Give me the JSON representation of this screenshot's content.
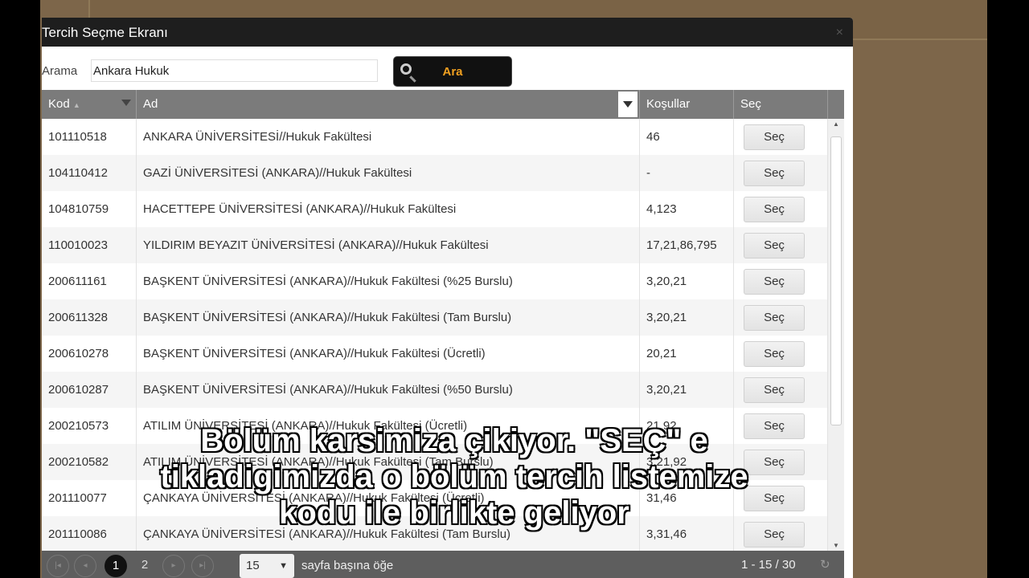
{
  "dialog": {
    "title": "Tercih Seçme Ekranı",
    "close": "×"
  },
  "search": {
    "label": "Arama",
    "value": "Ankara Hukuk",
    "button": "Ara"
  },
  "grid": {
    "headers": {
      "kod": "Kod",
      "sort": "▲",
      "ad": "Ad",
      "kosullar": "Koşullar",
      "sec": "Seç"
    },
    "rows": [
      {
        "kod": "101110518",
        "ad": "ANKARA ÜNİVERSİTESİ//Hukuk Fakültesi",
        "kosullar": "46",
        "btn": "Seç"
      },
      {
        "kod": "104110412",
        "ad": "GAZİ ÜNİVERSİTESİ (ANKARA)//Hukuk Fakültesi",
        "kosullar": "-",
        "btn": "Seç"
      },
      {
        "kod": "104810759",
        "ad": "HACETTEPE ÜNİVERSİTESİ (ANKARA)//Hukuk Fakültesi",
        "kosullar": "4,123",
        "btn": "Seç"
      },
      {
        "kod": "110010023",
        "ad": "YILDIRIM BEYAZIT ÜNİVERSİTESİ (ANKARA)//Hukuk Fakültesi",
        "kosullar": "17,21,86,795",
        "btn": "Seç"
      },
      {
        "kod": "200611161",
        "ad": "BAŞKENT ÜNİVERSİTESİ (ANKARA)//Hukuk Fakültesi (%25 Burslu)",
        "kosullar": "3,20,21",
        "btn": "Seç"
      },
      {
        "kod": "200611328",
        "ad": "BAŞKENT ÜNİVERSİTESİ (ANKARA)//Hukuk Fakültesi (Tam Burslu)",
        "kosullar": "3,20,21",
        "btn": "Seç"
      },
      {
        "kod": "200610278",
        "ad": "BAŞKENT ÜNİVERSİTESİ (ANKARA)//Hukuk Fakültesi (Ücretli)",
        "kosullar": "20,21",
        "btn": "Seç"
      },
      {
        "kod": "200610287",
        "ad": "BAŞKENT ÜNİVERSİTESİ (ANKARA)//Hukuk Fakültesi (%50 Burslu)",
        "kosullar": "3,20,21",
        "btn": "Seç"
      },
      {
        "kod": "200210573",
        "ad": "ATILIM ÜNİVERSİTESİ (ANKARA)//Hukuk Fakültesi (Ücretli)",
        "kosullar": "21,92",
        "btn": "Seç"
      },
      {
        "kod": "200210582",
        "ad": "ATILIM ÜNİVERSİTESİ (ANKARA)//Hukuk Fakültesi (Tam Burslu)",
        "kosullar": "3,21,92",
        "btn": "Seç"
      },
      {
        "kod": "201110077",
        "ad": "ÇANKAYA ÜNİVERSİTESİ (ANKARA)//Hukuk Fakültesi (Ücretli)",
        "kosullar": "31,46",
        "btn": "Seç"
      },
      {
        "kod": "201110086",
        "ad": "ÇANKAYA ÜNİVERSİTESİ (ANKARA)//Hukuk Fakültesi (Tam Burslu)",
        "kosullar": "3,31,46",
        "btn": "Seç"
      }
    ]
  },
  "pager": {
    "first": "|◂",
    "prev": "◂",
    "pages": [
      "1",
      "2"
    ],
    "next": "▸",
    "last": "▸|",
    "page_size": "15",
    "page_size_arrow": "▼",
    "page_size_label": "sayfa başına öğe",
    "info": "1 - 15 / 30",
    "refresh": "↻"
  },
  "caption": {
    "line1": "Bölüm karsimiza çikiyor.  \"SEÇ\" e",
    "line2": "tikladigimizda o bölüm tercih listemize",
    "line3": "kodu ile birlikte geliyor"
  }
}
